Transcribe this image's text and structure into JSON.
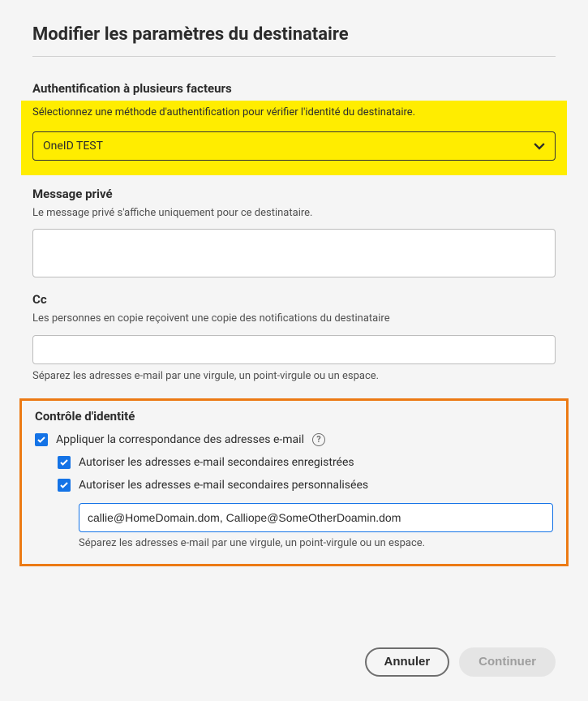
{
  "title": "Modifier les paramètres du destinataire",
  "auth": {
    "label": "Authentification à plusieurs facteurs",
    "helper": "Sélectionnez une méthode d'authentification pour vérifier l'identité du destinataire.",
    "selected": "OneID TEST"
  },
  "privateMessage": {
    "label": "Message privé",
    "helper": "Le message privé s'affiche uniquement pour ce destinataire.",
    "value": ""
  },
  "cc": {
    "label": "Cc",
    "helper": "Les personnes en copie reçoivent une copie des notifications du destinataire",
    "value": "",
    "postHelper": "Séparez les adresses e-mail par une virgule, un point-virgule ou un espace."
  },
  "identity": {
    "label": "Contrôle d'identité",
    "enforceMatch": "Appliquer la correspondance des adresses e-mail",
    "allowRegistered": "Autoriser les adresses e-mail secondaires enregistrées",
    "allowCustom": "Autoriser les adresses e-mail secondaires personnalisées",
    "emails": "callie@HomeDomain.dom, Calliope@SomeOtherDoamin.dom",
    "emailsHelper": "Séparez les adresses e-mail par une virgule, un point-virgule ou un espace."
  },
  "buttons": {
    "cancel": "Annuler",
    "continue": "Continuer"
  }
}
